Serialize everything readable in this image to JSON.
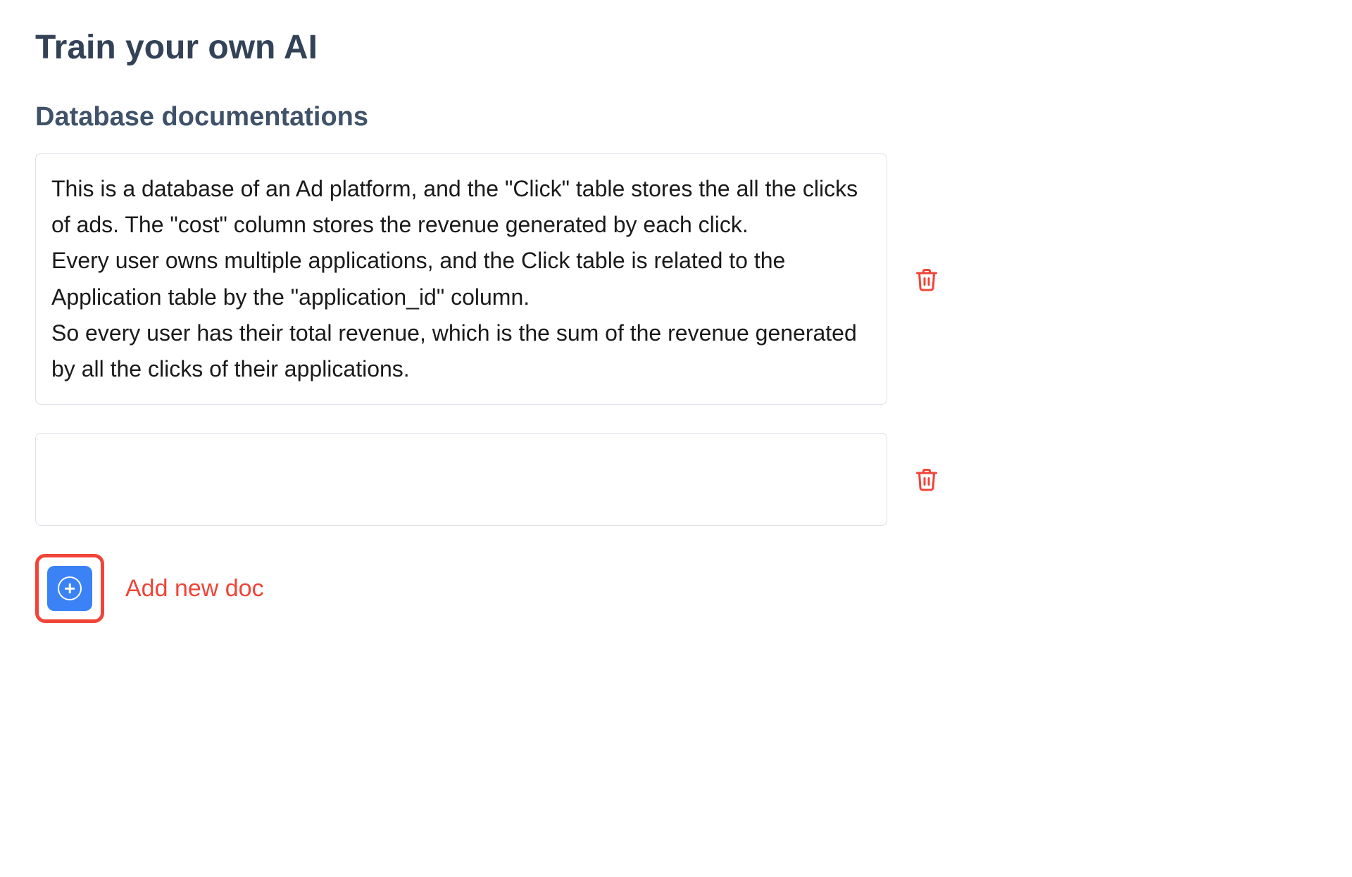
{
  "page": {
    "title": "Train your own AI"
  },
  "section": {
    "title": "Database documentations"
  },
  "docs": [
    {
      "text": "This is a database of an Ad platform, and the \"Click\" table stores the all the clicks of ads. The \"cost\" column stores the revenue generated by each click.\nEvery user owns multiple applications, and the Click table is related to the Application table by the \"application_id\" column.\nSo every user has their total revenue, which is the sum of the revenue generated by all the clicks of their applications."
    },
    {
      "text": ""
    }
  ],
  "actions": {
    "add_doc_label": "Add new doc"
  },
  "colors": {
    "accent_red": "#f04438",
    "accent_blue": "#3b82f6",
    "heading_dark": "#334257"
  }
}
